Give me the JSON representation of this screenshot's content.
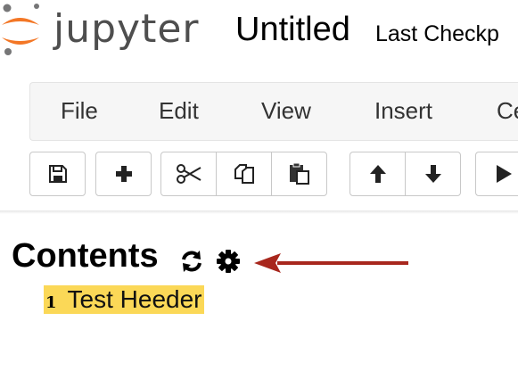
{
  "header": {
    "logo_text": "jupyter",
    "notebook_title": "Untitled",
    "checkpoint_text": "Last Checkp"
  },
  "menubar": {
    "items": [
      "File",
      "Edit",
      "View",
      "Insert",
      "Ce"
    ]
  },
  "toolbar": {
    "buttons": [
      {
        "icon": "save-icon"
      },
      {
        "icon": "plus-icon"
      },
      {
        "icon": "cut-icon"
      },
      {
        "icon": "copy-icon"
      },
      {
        "icon": "paste-icon"
      },
      {
        "icon": "arrow-up-icon"
      },
      {
        "icon": "arrow-down-icon"
      },
      {
        "icon": "run-icon"
      }
    ]
  },
  "toc": {
    "title": "Contents",
    "entries": [
      {
        "number": "1",
        "label": "Test Heeder"
      }
    ]
  },
  "colors": {
    "logo_orange": "#f37726",
    "logo_gray": "#767677",
    "highlight": "#fbd857",
    "annotation_arrow": "#a8271d",
    "menubar_bg": "#f6f6f6"
  }
}
